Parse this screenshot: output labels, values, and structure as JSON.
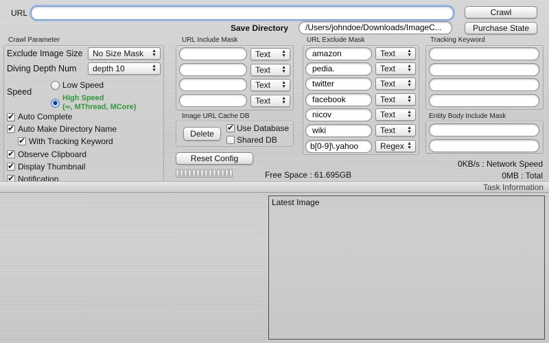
{
  "url": {
    "label": "URL",
    "value": ""
  },
  "top_buttons": {
    "crawl": "Crawl",
    "purchase_state": "Purchase State"
  },
  "save_directory": {
    "label": "Save Directory",
    "value": "/Users/johndoe/Downloads/ImageC..."
  },
  "crawl_parameter": {
    "title": "Crawl Parameter",
    "exclude_image_size": {
      "label": "Exclude Image Size",
      "value": "No Size Mask"
    },
    "diving_depth": {
      "label": "Diving Depth Num",
      "value": "depth 10"
    },
    "speed": {
      "label": "Speed",
      "low": "Low Speed",
      "high": "High Speed",
      "high_detail": "(∞, MThread, MCore)",
      "selected": "high"
    },
    "checkboxes": [
      {
        "label": "Auto Complete",
        "checked": true
      },
      {
        "label": "Auto Make Directory Name",
        "checked": true
      },
      {
        "label": "With Tracking Keyword",
        "checked": true
      },
      {
        "label": "Observe Clipboard",
        "checked": true
      },
      {
        "label": "Display Thumbnail",
        "checked": true
      },
      {
        "label": "Notification",
        "checked": true
      }
    ]
  },
  "url_include_mask": {
    "title": "URL Include Mask",
    "rows": [
      {
        "value": "",
        "type": "Text"
      },
      {
        "value": "",
        "type": "Text"
      },
      {
        "value": "",
        "type": "Text"
      },
      {
        "value": "",
        "type": "Text"
      }
    ]
  },
  "url_exclude_mask": {
    "title": "URL Exclude Mask",
    "rows": [
      {
        "value": "amazon",
        "type": "Text"
      },
      {
        "value": "pedia.",
        "type": "Text"
      },
      {
        "value": "twitter",
        "type": "Text"
      },
      {
        "value": "facebook",
        "type": "Text"
      },
      {
        "value": "nicov",
        "type": "Text"
      },
      {
        "value": "wiki",
        "type": "Text"
      },
      {
        "value": "b[0-9]\\.yahoo",
        "type": "Regex"
      }
    ]
  },
  "tracking_keyword": {
    "title": "Tracking Keyword",
    "values": [
      "",
      "",
      "",
      ""
    ]
  },
  "entity_body_mask": {
    "title": "Entity Body Include Mask",
    "values": [
      "",
      ""
    ]
  },
  "cache_db": {
    "title": "Image URL Cache DB",
    "delete": "Delete",
    "use_database": {
      "label": "Use Database",
      "checked": true
    },
    "shared_db": {
      "label": "Shared DB",
      "checked": false
    }
  },
  "reset_config": "Reset Config",
  "progress": {
    "fraction": 0.0,
    "segments": 14
  },
  "free_space": "Free Space : 61.695GB",
  "network_speed": "0KB/s : Network Speed",
  "total": "0MB  : Total",
  "task_information": "Task Information",
  "latest_image": "Latest Image"
}
